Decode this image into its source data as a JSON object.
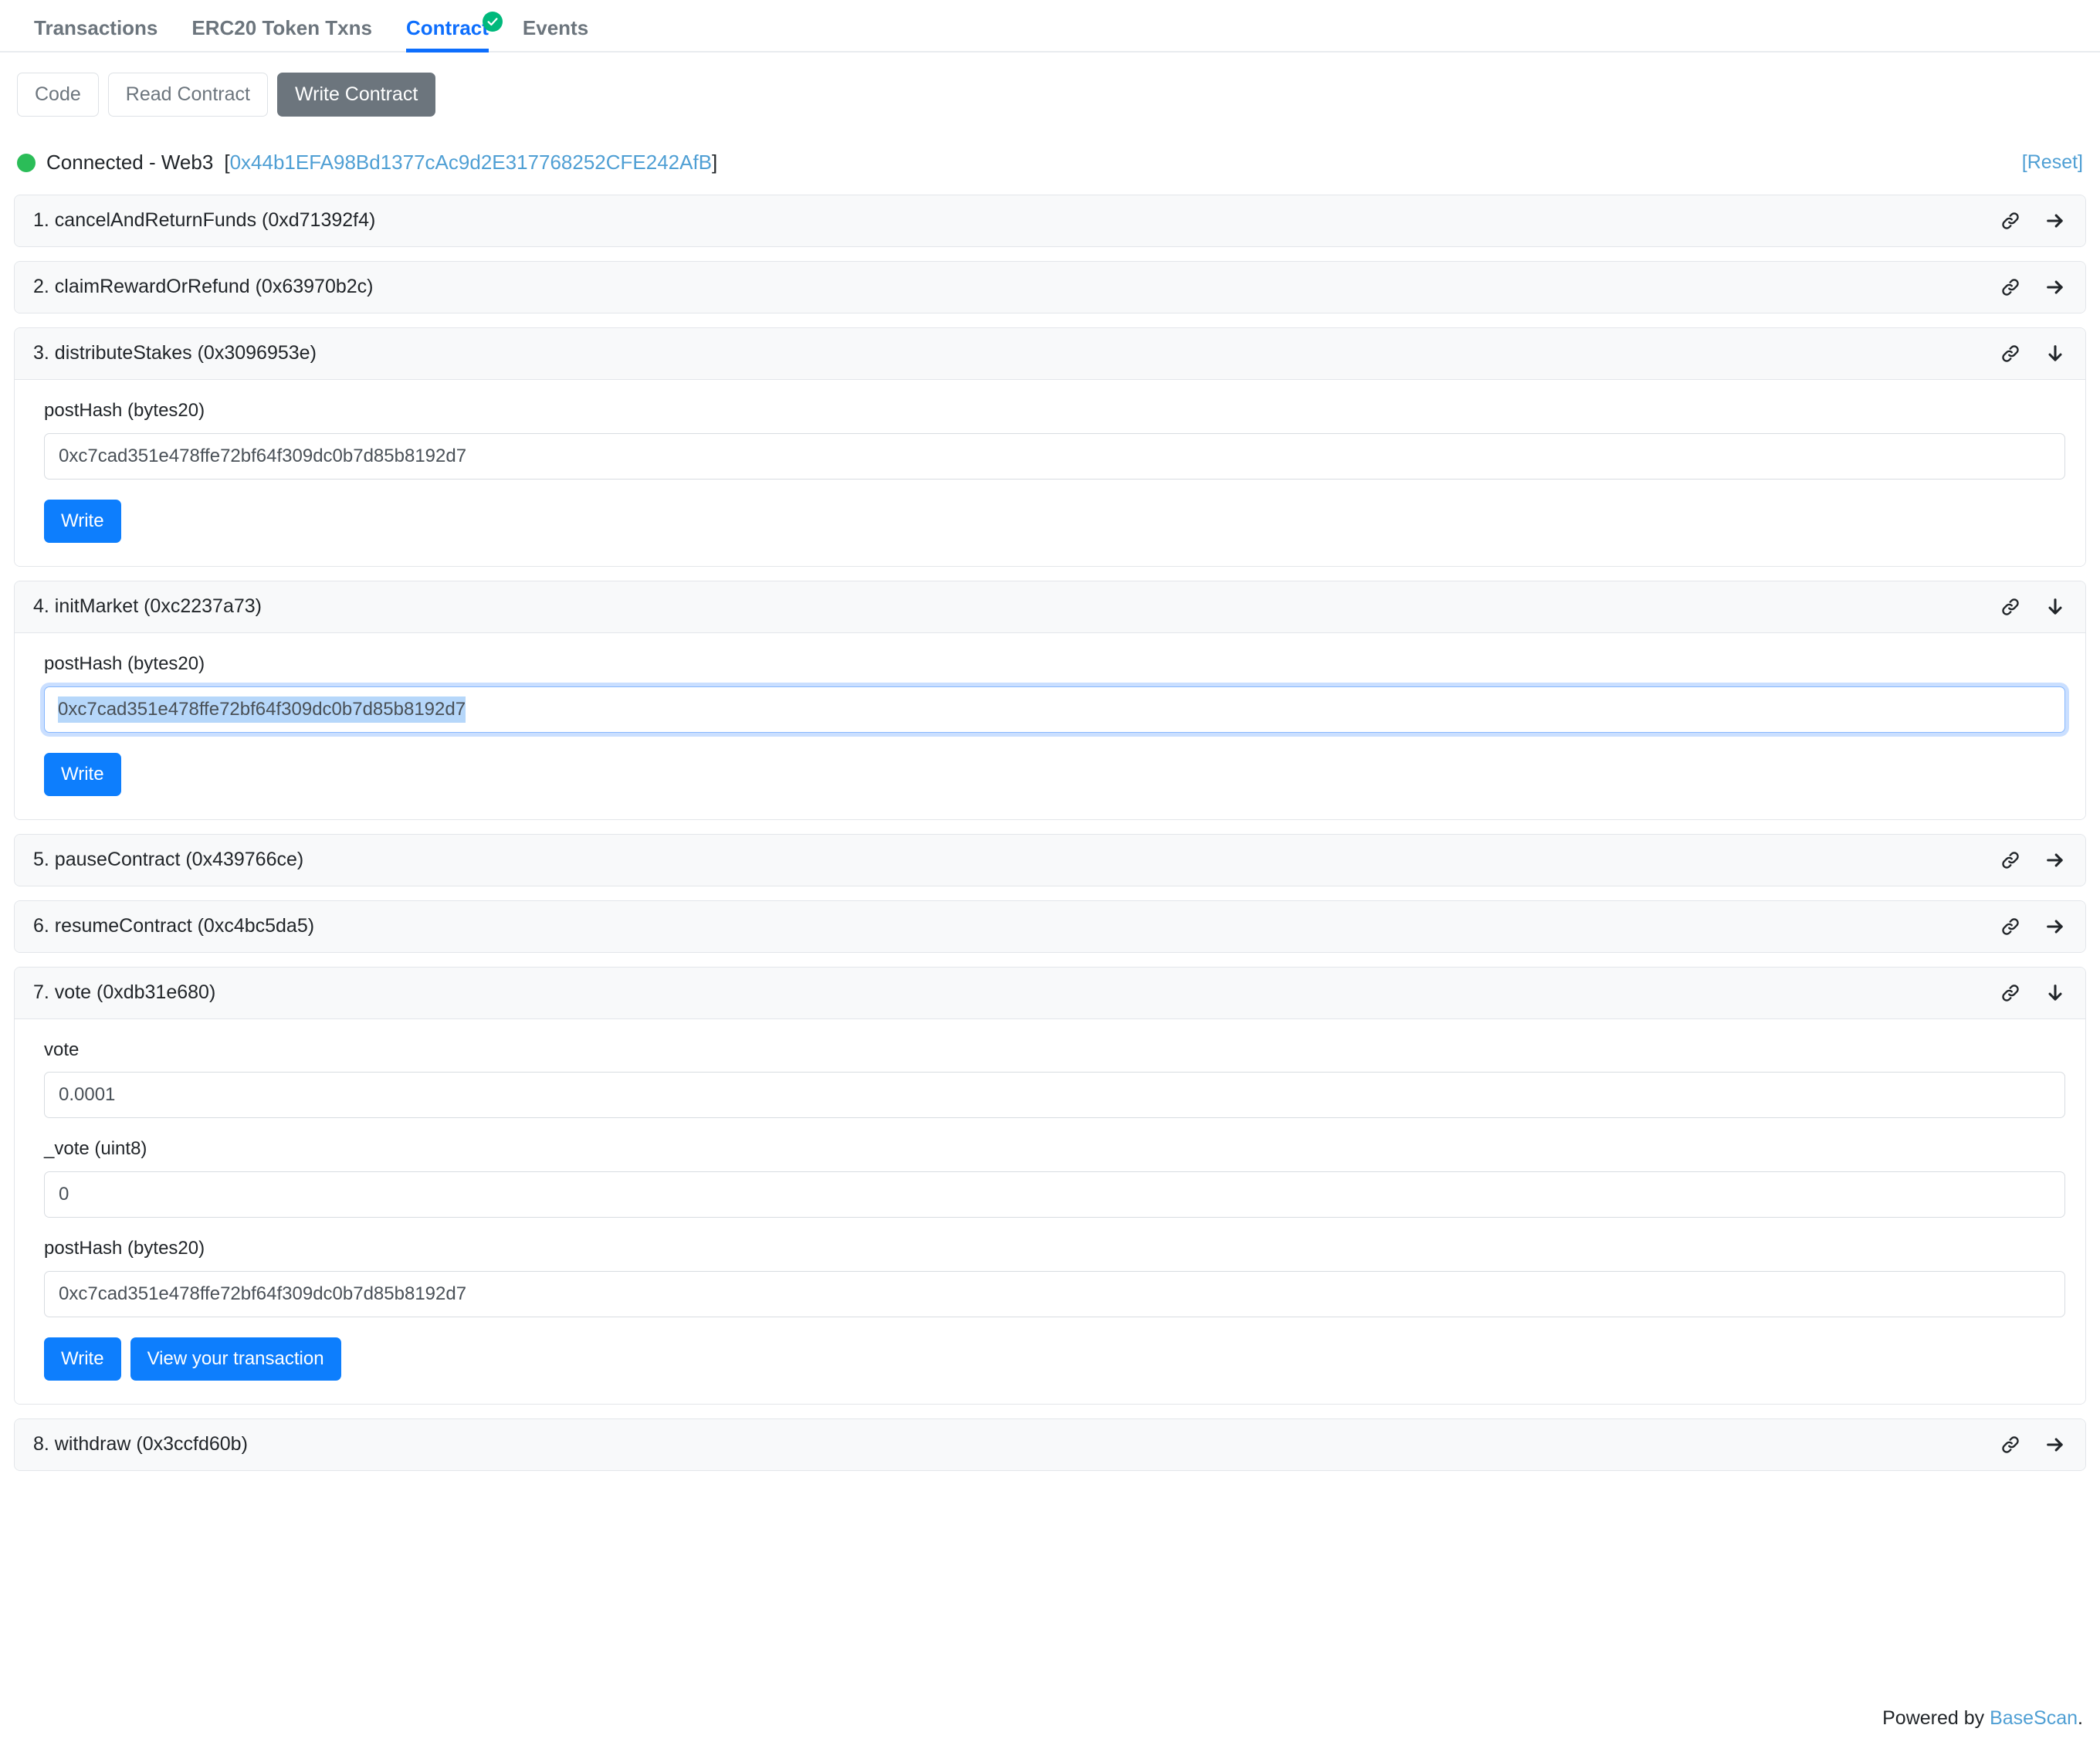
{
  "tabs": [
    {
      "label": "Transactions",
      "active": false,
      "verified": false
    },
    {
      "label": "ERC20 Token Txns",
      "active": false,
      "verified": false
    },
    {
      "label": "Contract",
      "active": true,
      "verified": true
    },
    {
      "label": "Events",
      "active": false,
      "verified": false
    }
  ],
  "subnav": [
    {
      "label": "Code",
      "active": false
    },
    {
      "label": "Read Contract",
      "active": false
    },
    {
      "label": "Write Contract",
      "active": true
    }
  ],
  "connection": {
    "status_label": "Connected - Web3",
    "bracket_open": "[",
    "address": "0x44b1EFA98Bd1377cAc9d2E317768252CFE242AfB",
    "bracket_close": "]",
    "reset_label": "[Reset]",
    "dot_color": "#2bbd58"
  },
  "functions": [
    {
      "title": "1. cancelAndReturnFunds (0xd71392f4)",
      "expanded": false,
      "arrow": "right"
    },
    {
      "title": "2. claimRewardOrRefund (0x63970b2c)",
      "expanded": false,
      "arrow": "right"
    },
    {
      "title": "3. distributeStakes (0x3096953e)",
      "expanded": true,
      "arrow": "down",
      "fields": [
        {
          "label": "postHash (bytes20)",
          "value": "0xc7cad351e478ffe72bf64f309dc0b7d85b8192d7",
          "focused": false,
          "selected": false
        }
      ],
      "buttons": [
        {
          "label": "Write"
        }
      ]
    },
    {
      "title": "4. initMarket (0xc2237a73)",
      "expanded": true,
      "arrow": "down",
      "fields": [
        {
          "label": "postHash (bytes20)",
          "value": "0xc7cad351e478ffe72bf64f309dc0b7d85b8192d7",
          "focused": true,
          "selected": true
        }
      ],
      "buttons": [
        {
          "label": "Write"
        }
      ]
    },
    {
      "title": "5. pauseContract (0x439766ce)",
      "expanded": false,
      "arrow": "right"
    },
    {
      "title": "6. resumeContract (0xc4bc5da5)",
      "expanded": false,
      "arrow": "right"
    },
    {
      "title": "7. vote (0xdb31e680)",
      "expanded": true,
      "arrow": "down",
      "fields": [
        {
          "label": "vote",
          "value": "0.0001",
          "focused": false,
          "selected": false
        },
        {
          "label": "_vote (uint8)",
          "value": "0",
          "focused": false,
          "selected": false
        },
        {
          "label": "postHash (bytes20)",
          "value": "0xc7cad351e478ffe72bf64f309dc0b7d85b8192d7",
          "focused": false,
          "selected": false
        }
      ],
      "buttons": [
        {
          "label": "Write"
        },
        {
          "label": "View your transaction"
        }
      ]
    },
    {
      "title": "8. withdraw (0x3ccfd60b)",
      "expanded": false,
      "arrow": "right"
    }
  ],
  "footer": {
    "prefix": "Powered by ",
    "link": "BaseScan",
    "suffix": "."
  },
  "colors": {
    "accent_blue": "#0d6efd",
    "button_blue": "#0d7efd",
    "link_blue": "#4f9fd4",
    "verified_green": "#00b97c",
    "header_bg": "#f8f9fa"
  },
  "icons": {
    "link": "link-icon",
    "arrow_right": "arrow-right-icon",
    "arrow_down": "arrow-down-icon",
    "verified": "verified-check-icon"
  }
}
